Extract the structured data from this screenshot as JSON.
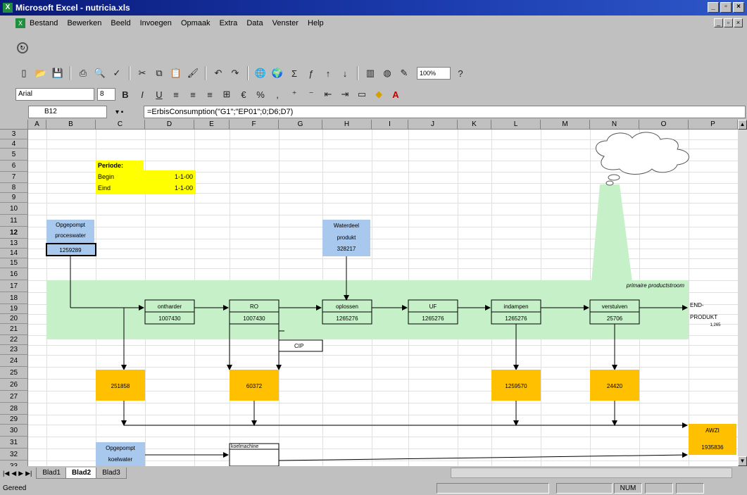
{
  "window": {
    "title": "Microsoft Excel - nutricia.xls"
  },
  "menu": [
    "Bestand",
    "Bewerken",
    "Beeld",
    "Invoegen",
    "Opmaak",
    "Extra",
    "Data",
    "Venster",
    "Help"
  ],
  "toolbar": {
    "zoom": "100%",
    "font": "Arial",
    "size": "8"
  },
  "formula_bar": {
    "cell": "B12",
    "formula": "=ErbisConsumption(\"G1\";\"EP01\";0;D6;D7)"
  },
  "columns": [
    "A",
    "B",
    "C",
    "D",
    "E",
    "F",
    "G",
    "H",
    "I",
    "J",
    "K",
    "L",
    "M",
    "N",
    "O",
    "P"
  ],
  "rows": [
    "3",
    "4",
    "5",
    "6",
    "7",
    "8",
    "9",
    "10",
    "11",
    "12",
    "13",
    "14",
    "15",
    "16",
    "17",
    "18",
    "19",
    "20",
    "21",
    "22",
    "23",
    "24",
    "25",
    "26",
    "27",
    "28",
    "29",
    "30",
    "31",
    "32",
    "33"
  ],
  "periode": {
    "title": "Periode:",
    "begin_label": "Begin",
    "begin_value": "1-1-00",
    "end_label": "Eind",
    "end_value": "1-1-00"
  },
  "diagram": {
    "opgepompt_proceswater": {
      "line1": "Opgepompt",
      "line2": "proceswater",
      "value": "1259289"
    },
    "waterdeel_produkt": {
      "line1": "Waterdeel",
      "line2": "produkt",
      "value": "328217"
    },
    "primaire_label": "primaire productstroom",
    "steps": [
      {
        "name": "ontharder",
        "value": "1007430"
      },
      {
        "name": "RO",
        "value": "1007430"
      },
      {
        "name": "oplossen",
        "value": "1265276"
      },
      {
        "name": "UF",
        "value": "1265276"
      },
      {
        "name": "indampen",
        "value": "1265276"
      },
      {
        "name": "verstuiven",
        "value": "25706"
      }
    ],
    "end_product": {
      "line1": "END-",
      "line2": "PRODUKT",
      "value": "1,265"
    },
    "cip": "CIP",
    "outflows": [
      "251858",
      "60372",
      "1259570",
      "24420"
    ],
    "awzi": {
      "label": "AWZI",
      "value": "1935836"
    },
    "opgepompt_koelwater": {
      "line1": "Opgepompt",
      "line2": "koelwater"
    },
    "koelmachine": "koelmachine"
  },
  "sheets": [
    "Blad1",
    "Blad2",
    "Blad3"
  ],
  "active_sheet": "Blad2",
  "status": {
    "text": "Gereed",
    "num": "NUM"
  }
}
